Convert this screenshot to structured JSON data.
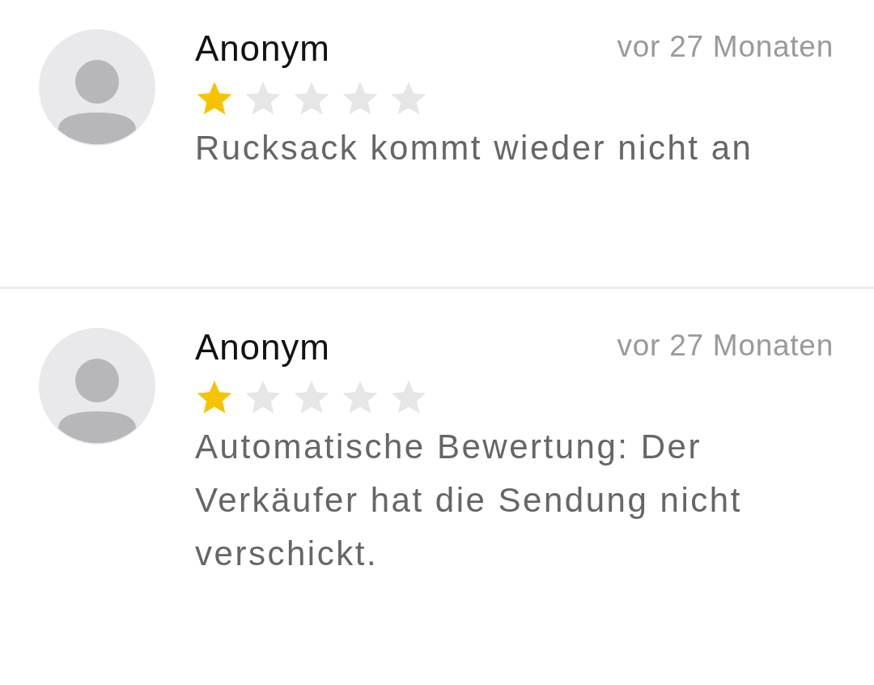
{
  "reviews": [
    {
      "author": "Anonym",
      "time": "vor 27 Monaten",
      "stars": 1,
      "text": "Rucksack kommt wieder nicht an"
    },
    {
      "author": "Anonym",
      "time": "vor 27 Monaten",
      "stars": 1,
      "text": "Automatische Bewertung: Der Verkäufer hat die Sendung nicht verschickt."
    }
  ]
}
